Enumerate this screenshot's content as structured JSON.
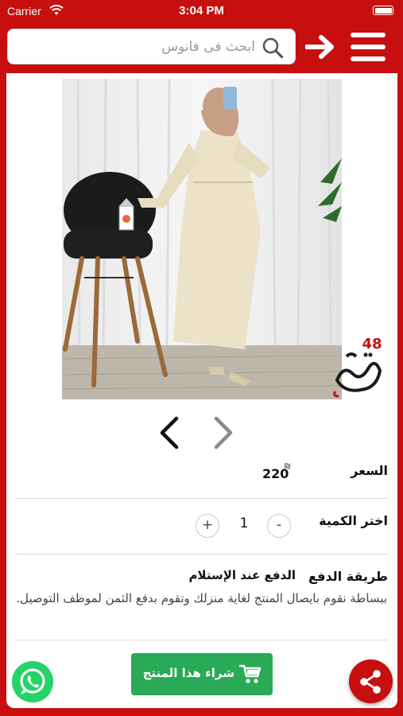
{
  "status_bar": {
    "carrier": "Carrier",
    "time": "3:04 PM"
  },
  "header": {
    "search_placeholder": "ابحث فى فانوس"
  },
  "product": {
    "logo_text": "فانوس",
    "logo_number": "48"
  },
  "price": {
    "label": "السعر",
    "value": "220",
    "currency": "₪"
  },
  "quantity": {
    "label": "اختر الكمية",
    "value": "1",
    "plus": "+",
    "minus": "-"
  },
  "payment": {
    "label": "طريقة الدفع",
    "method_title": "الدفع عند الإستلام",
    "method_description": "ببساطة نقوم بايصال المنتج لغاية منزلك وتقوم بدفع الثمن لموظف التوصيل."
  },
  "buy_button": {
    "label": "شراء هذا المنتج"
  },
  "icons": {
    "search": "search-icon",
    "back": "arrow-right-icon",
    "menu": "hamburger-menu-icon",
    "prev": "chevron-left-icon",
    "next": "chevron-right-icon",
    "cart": "cart-icon",
    "whatsapp": "whatsapp-icon",
    "share": "share-icon"
  },
  "colors": {
    "brand_red": "#c70f0f",
    "buy_green": "#2aaa56",
    "whatsapp_green": "#25d366"
  }
}
